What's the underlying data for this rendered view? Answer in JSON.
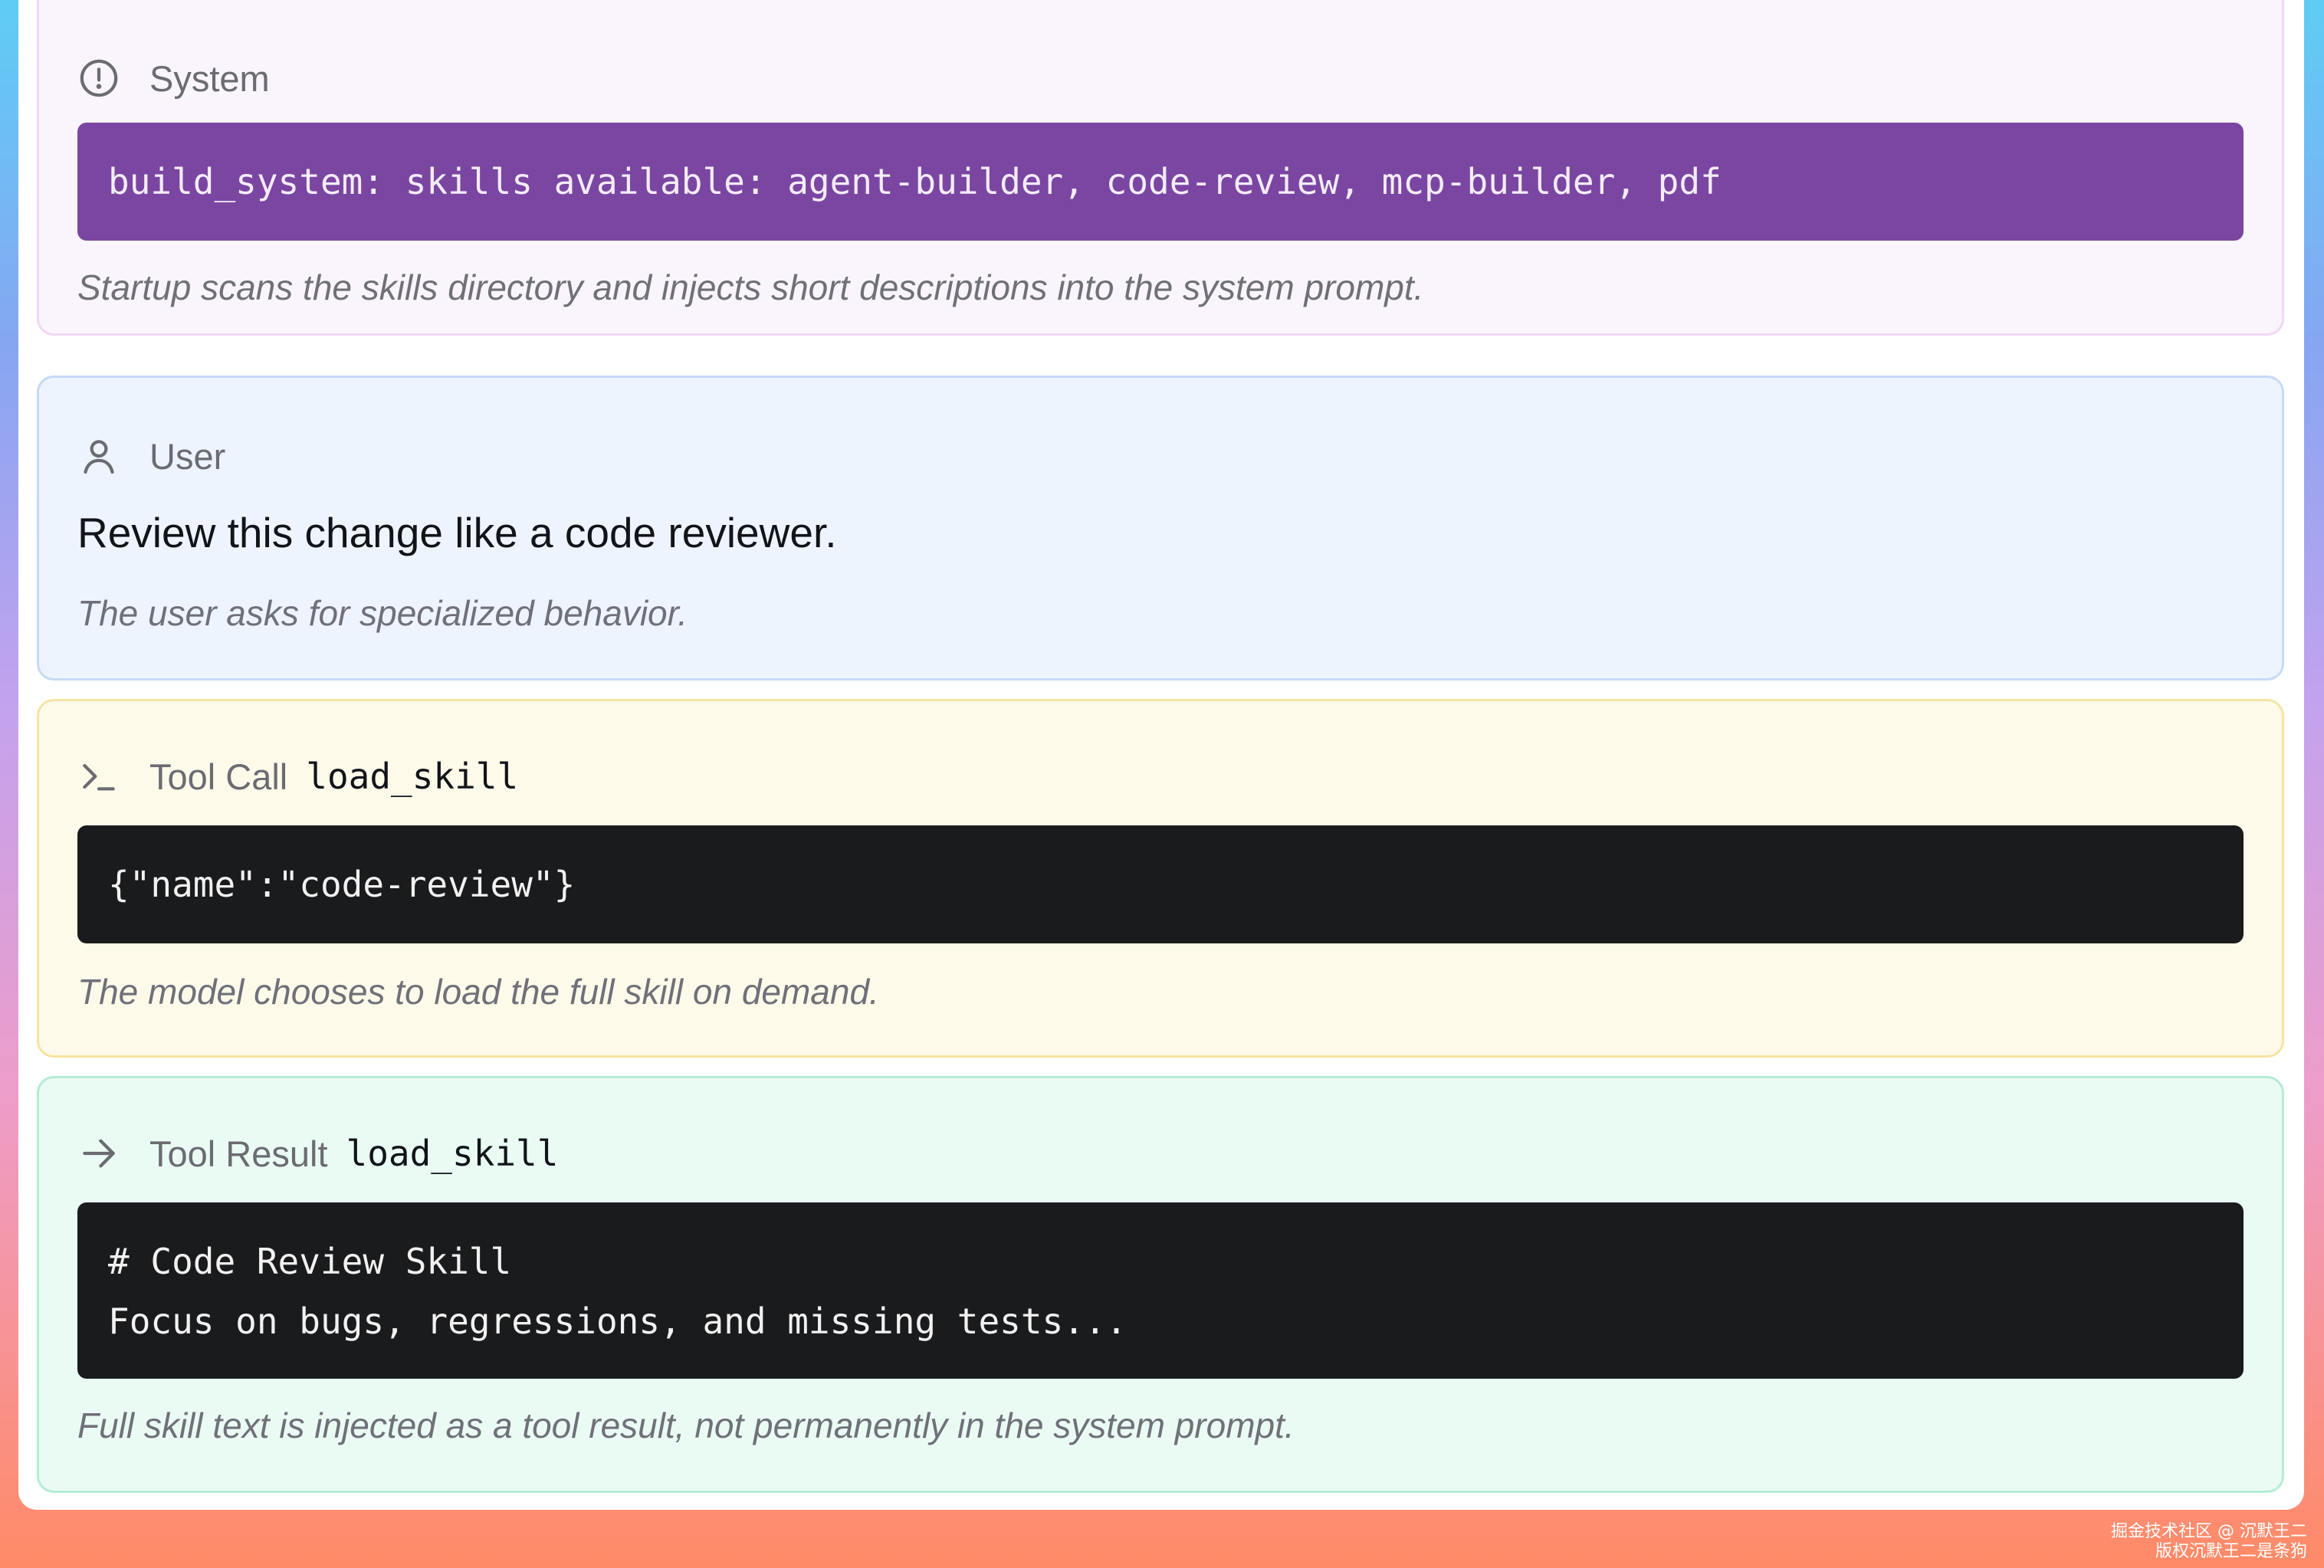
{
  "system": {
    "label": "System",
    "code": "build_system: skills available: agent-builder, code-review, mcp-builder, pdf",
    "note": "Startup scans the skills directory and injects short descriptions into the system prompt."
  },
  "user": {
    "label": "User",
    "message": "Review this change like a code reviewer.",
    "note": "The user asks for specialized behavior."
  },
  "tool_call": {
    "label": "Tool Call",
    "tool_name": "load_skill",
    "code": "{\"name\":\"code-review\"}",
    "note": "The model chooses to load the full skill on demand."
  },
  "tool_result": {
    "label": "Tool Result",
    "tool_name": "load_skill",
    "code_lines": [
      "# Code Review Skill",
      "Focus on bugs, regressions, and missing tests..."
    ],
    "note": "Full skill text is injected as a tool result, not permanently in the system prompt."
  },
  "watermark": {
    "line1": "掘金技术社区 @ 沉默王二",
    "line2": "版权沉默王二是条狗"
  },
  "colors": {
    "system_bg": "#faf4fd",
    "system_code_bg": "#7a46a2",
    "user_bg": "#eef4fe",
    "tool_call_bg": "#fefaea",
    "tool_result_bg": "#eafbf4",
    "code_dark_bg": "#1a1b1d"
  },
  "icons": {
    "system": "alert-circle-icon",
    "user": "user-icon",
    "tool_call": "terminal-icon",
    "tool_result": "arrow-right-icon"
  }
}
